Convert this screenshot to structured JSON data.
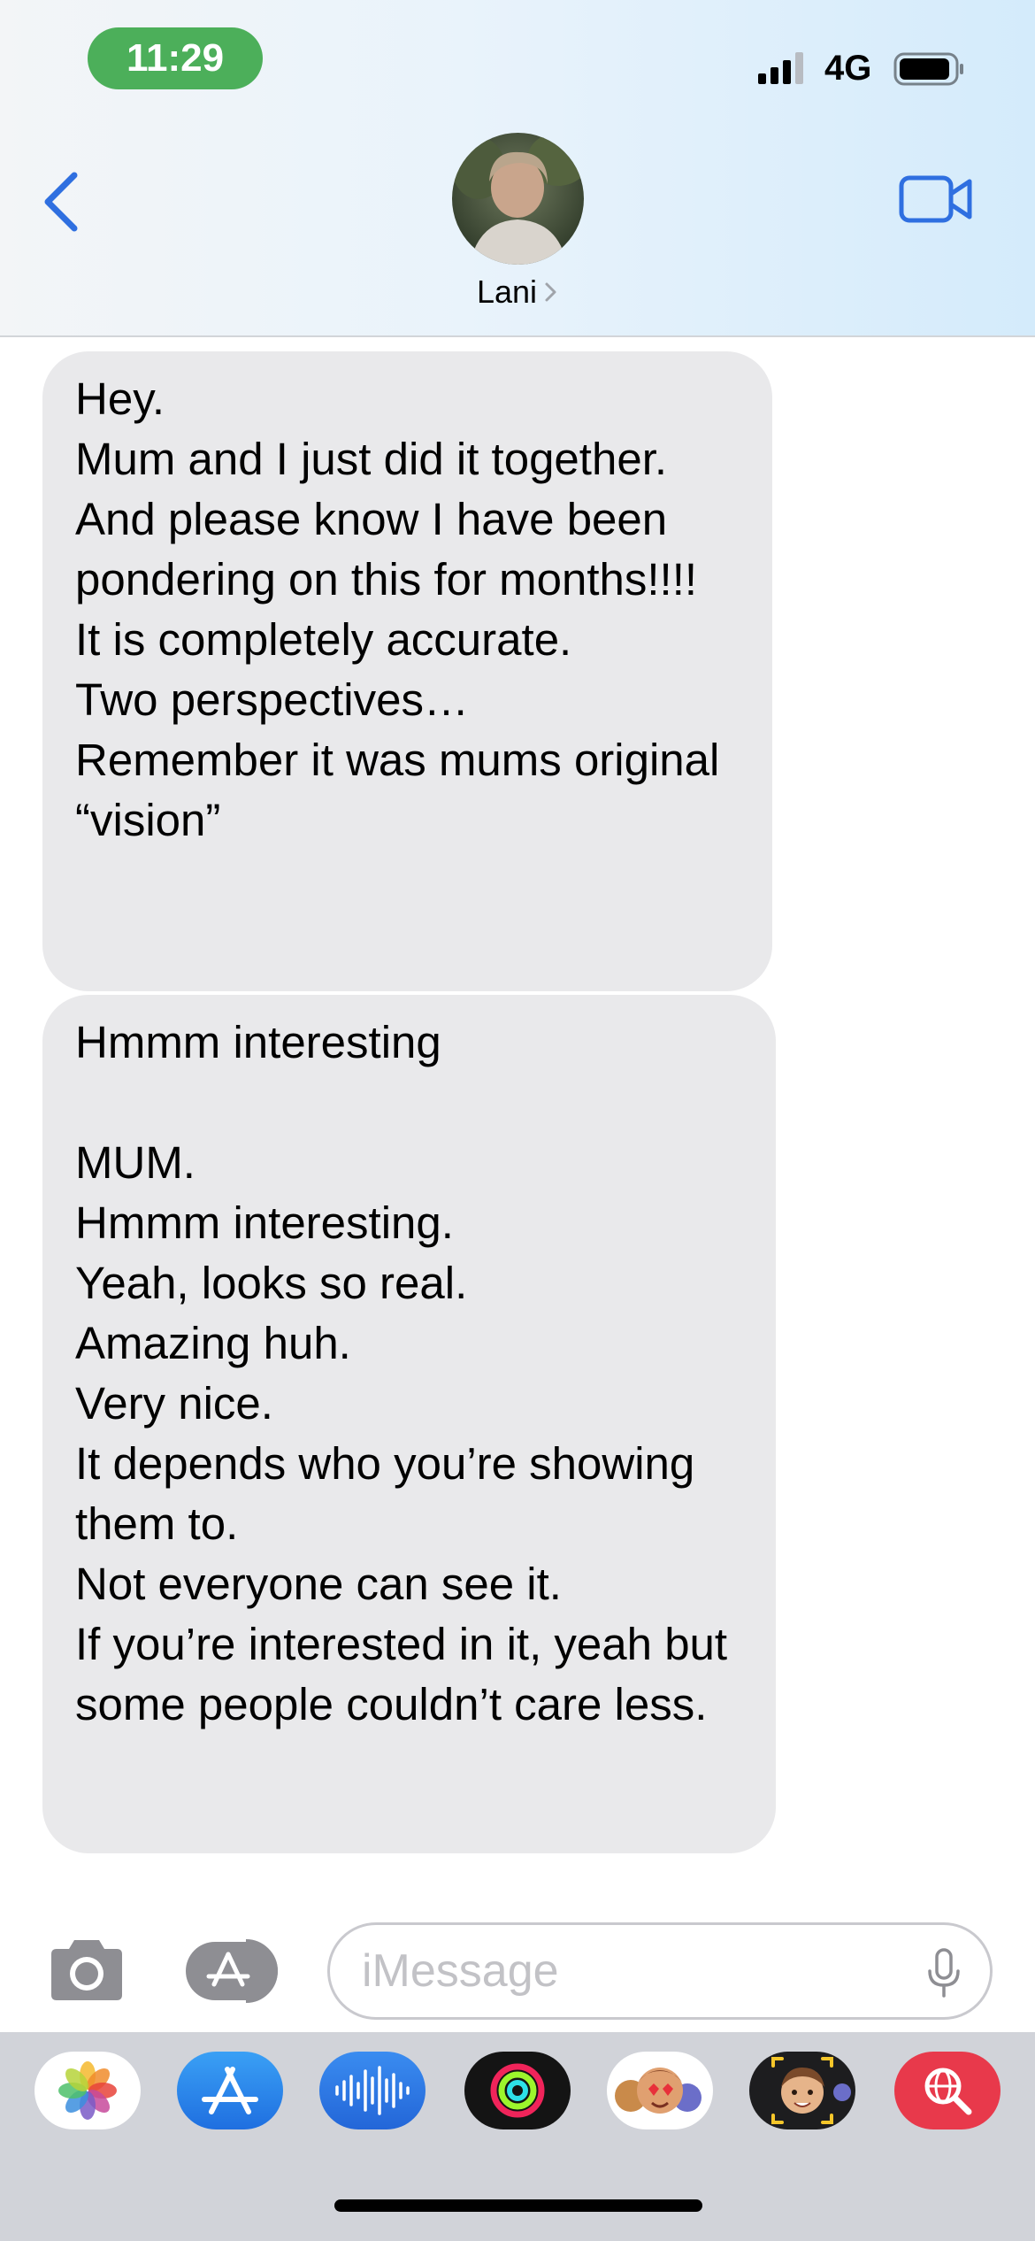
{
  "status_bar": {
    "time": "11:29",
    "network": "4G",
    "time_pill_color": "#4caf5a"
  },
  "header": {
    "contact_name": "Lani",
    "back_icon": "chevron-left-icon",
    "video_icon": "video-camera-icon",
    "accent_color": "#2f6fe0"
  },
  "messages": [
    {
      "direction": "incoming",
      "text": "Hey.\nMum and I just did it together.\nAnd please know I have been pondering on this for months!!!!\nIt is completely accurate.\nTwo perspectives…\nRemember it was mums original “vision”"
    },
    {
      "direction": "incoming",
      "text": "Hmmm interesting\n\nMUM.\nHmmm interesting.\nYeah, looks so real.\nAmazing huh.\nVery nice.\nIt depends who you’re showing them to.\nNot everyone can see it.\nIf you’re interested in it, yeah but some people couldn’t care less."
    }
  ],
  "compose": {
    "placeholder": "iMessage",
    "camera_icon": "camera-icon",
    "apps_icon": "app-store-icon",
    "mic_icon": "microphone-icon"
  },
  "app_drawer": [
    {
      "name": "photos-icon"
    },
    {
      "name": "app-store-icon"
    },
    {
      "name": "audio-message-icon"
    },
    {
      "name": "activity-icon"
    },
    {
      "name": "memoji-stickers-icon"
    },
    {
      "name": "memoji-icon"
    },
    {
      "name": "web-search-icon"
    }
  ],
  "bubble_color": "#e9e9eb"
}
